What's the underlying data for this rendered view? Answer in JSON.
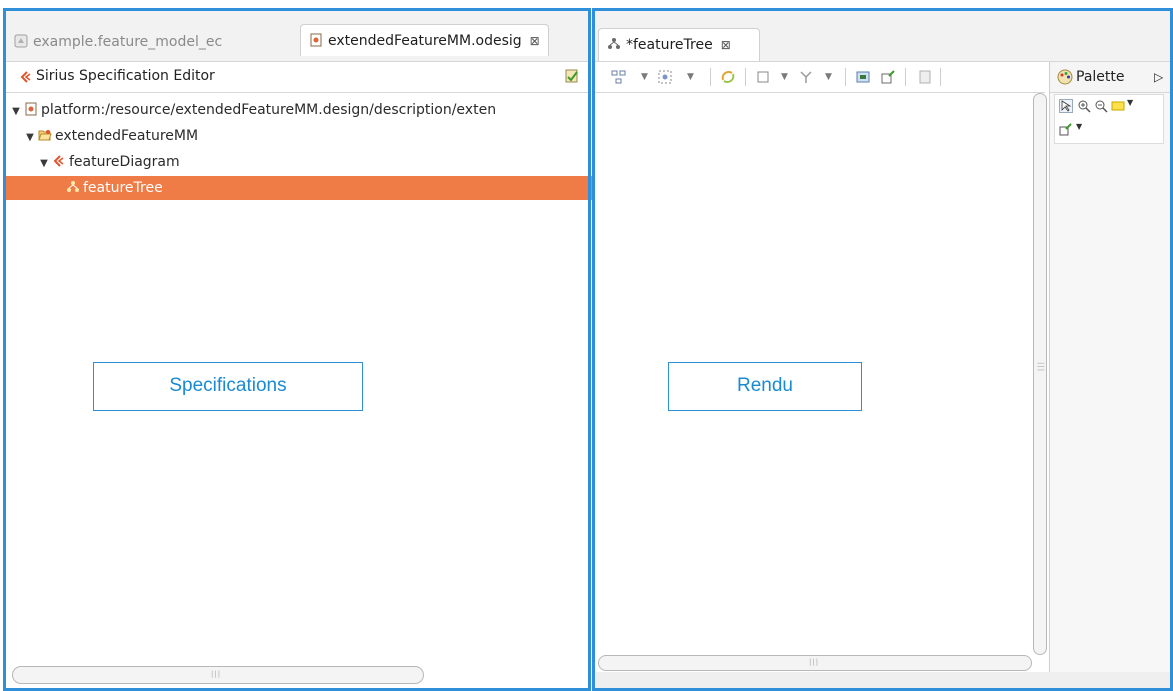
{
  "left_editor": {
    "tabs": [
      {
        "label": "example.feature_model_ec",
        "active": false
      },
      {
        "label": "extendedFeatureMM.odesig",
        "active": true,
        "close": "⊠"
      }
    ],
    "header_title": "Sirius Specification Editor",
    "tree": [
      {
        "label": "platform:/resource/extendedFeatureMM.design/description/exten",
        "twisty": "▼",
        "icon": "odesign-file-icon"
      },
      {
        "label": "extendedFeatureMM",
        "twisty": "▼",
        "icon": "folder-open-icon"
      },
      {
        "label": "featureDiagram",
        "twisty": "▼",
        "icon": "diagram-description-icon"
      },
      {
        "label": "featureTree",
        "twisty": "",
        "icon": "layer-icon",
        "selected": true
      }
    ],
    "annotation": "Specifications"
  },
  "right_editor": {
    "tab": {
      "label": "*featureTree",
      "close": "⊠"
    },
    "palette_title": "Palette",
    "palette_toggle": "▷",
    "annotation": "Rendu"
  },
  "colors": {
    "frame": "#2f8fd8",
    "selection": "#ef7b47",
    "annotation_text": "#1a8ad3"
  }
}
